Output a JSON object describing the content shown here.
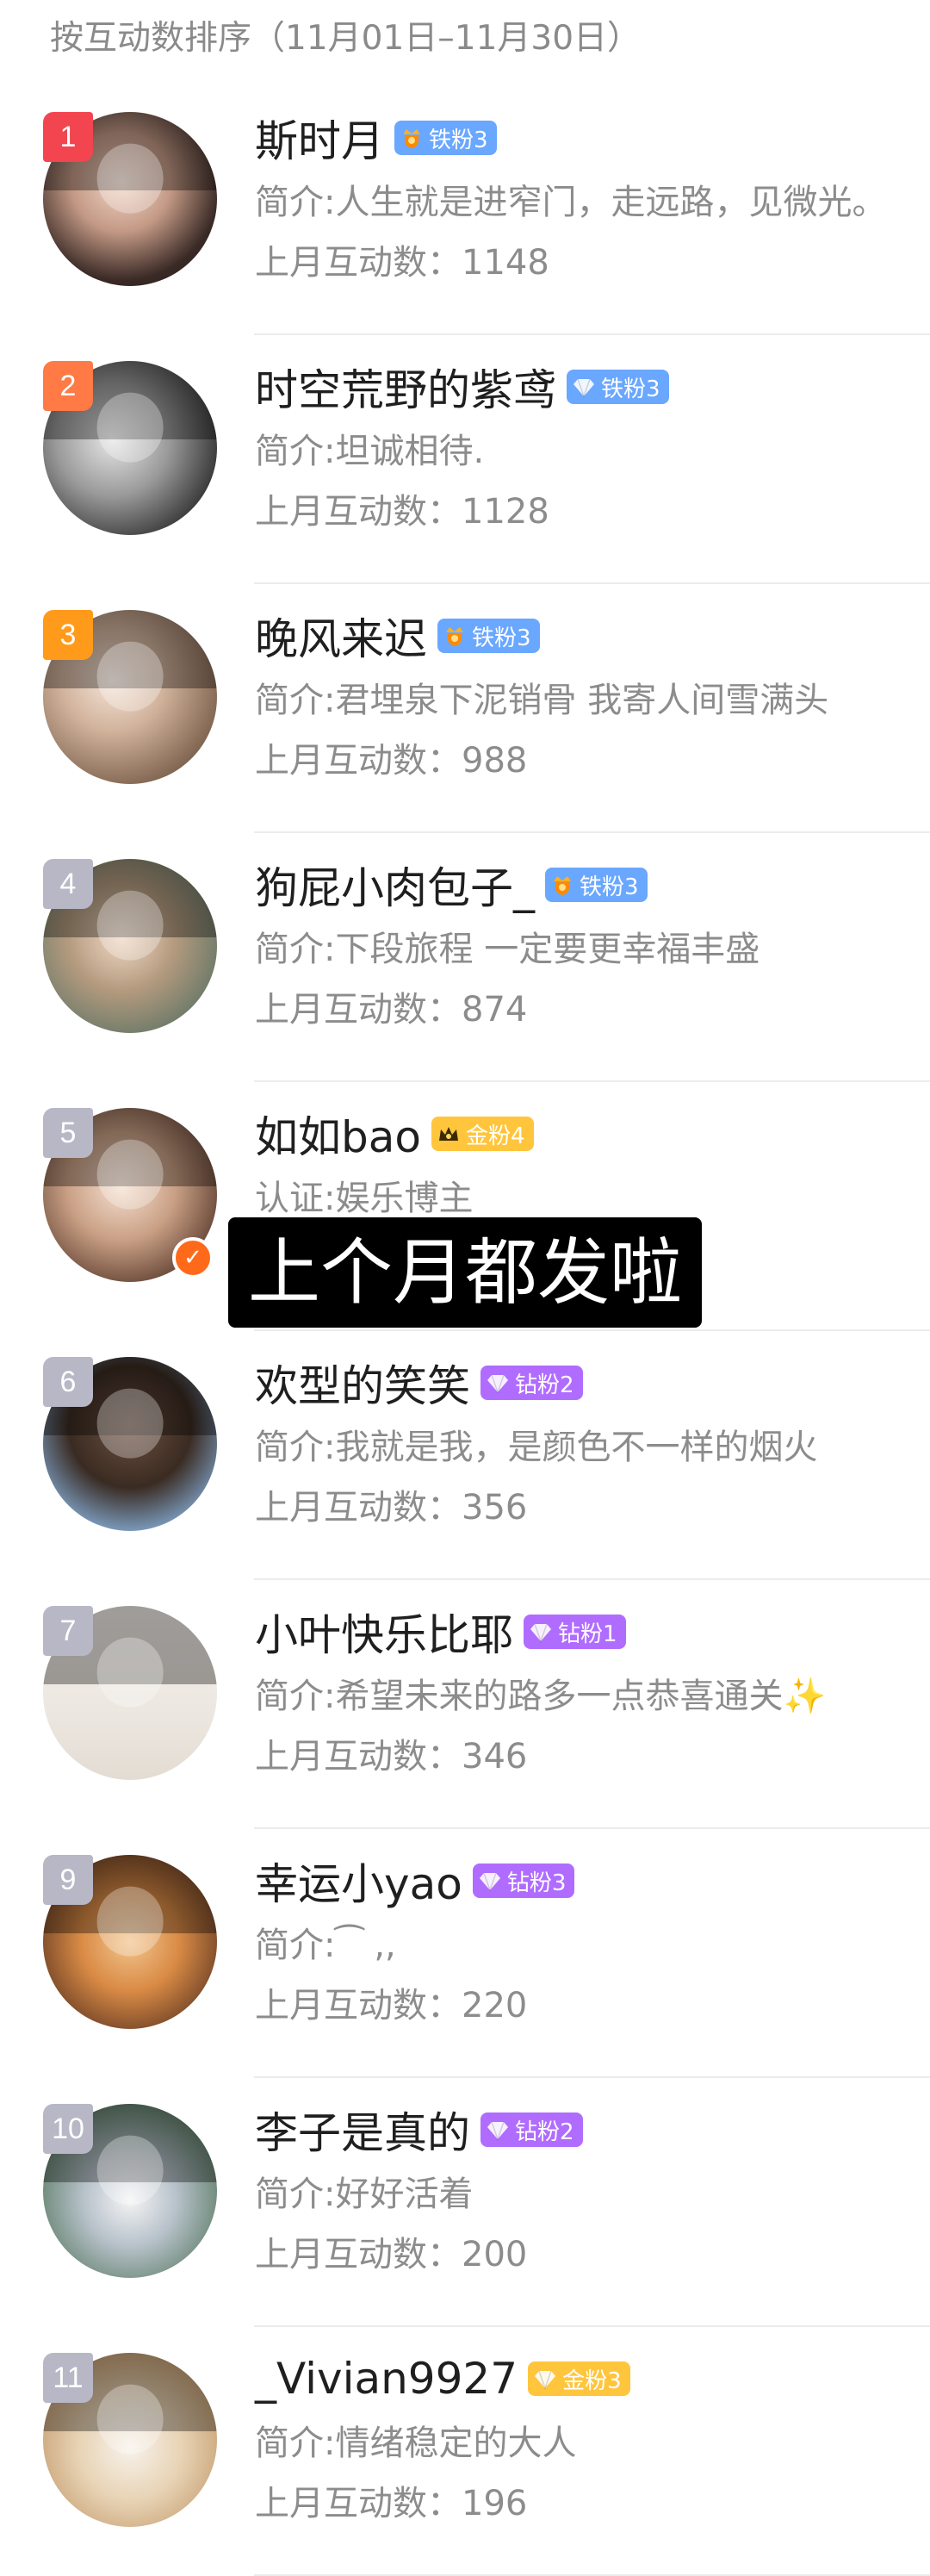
{
  "header": {
    "title": "按互动数排序（11月01日–11月30日）"
  },
  "caption": "上个月都发啦",
  "colors": {
    "rank_top1": "#f2454f",
    "rank_top2": "#ff7a45",
    "rank_top3": "#ff9a1a",
    "rank_default": "#b7b7c6",
    "badge_iron": "#6aa7ff",
    "badge_gold": "#ffc53d",
    "badge_diamond": "#b06cff",
    "verified": "#ff6a1a"
  },
  "users": [
    {
      "rank": "1",
      "name": "斯时月",
      "badge": "铁粉3",
      "badge_type": "iron",
      "badge_icon": "crown-shield-icon",
      "intro": "简介:人生就是进窄门，走远路，见微光。",
      "count": "上月互动数：1148",
      "verified": false
    },
    {
      "rank": "2",
      "name": "时空荒野的紫鸢",
      "badge": "铁粉3",
      "badge_type": "iron",
      "badge_icon": "diamond-icon",
      "intro": "简介:坦诚相待.",
      "count": "上月互动数：1128",
      "verified": false
    },
    {
      "rank": "3",
      "name": "晚风来迟",
      "badge": "铁粉3",
      "badge_type": "iron",
      "badge_icon": "crown-shield-icon",
      "intro": "简介:君埋泉下泥销骨 我寄人间雪满头",
      "count": "上月互动数：988",
      "verified": false
    },
    {
      "rank": "4",
      "name": "狗屁小肉包子_",
      "badge": "铁粉3",
      "badge_type": "iron",
      "badge_icon": "crown-shield-icon",
      "intro": "简介:下段旅程 一定要更幸福丰盛",
      "count": "上月互动数：874",
      "verified": false
    },
    {
      "rank": "5",
      "name": "如如bao",
      "badge": "金粉4",
      "badge_type": "gold",
      "badge_icon": "crown-icon",
      "intro": "认证:娱乐博主",
      "count": "",
      "verified": true
    },
    {
      "rank": "6",
      "name": "欢型的笑笑",
      "badge": "钻粉2",
      "badge_type": "diamond",
      "badge_icon": "diamond-icon",
      "intro": "简介:我就是我，是颜色不一样的烟火",
      "count": "上月互动数：356",
      "verified": false
    },
    {
      "rank": "7",
      "name": "小叶快乐比耶",
      "badge": "钻粉1",
      "badge_type": "diamond",
      "badge_icon": "diamond-icon",
      "intro": "简介:希望未来的路多一点恭喜通关✨",
      "count": "上月互动数：346",
      "verified": false
    },
    {
      "rank": "9",
      "name": "幸运小yao",
      "badge": "钻粉3",
      "badge_type": "diamond",
      "badge_icon": "diamond-icon",
      "intro": "简介:⁀ ,,",
      "count": "上月互动数：220",
      "verified": false
    },
    {
      "rank": "10",
      "name": "李子是真的",
      "badge": "钻粉2",
      "badge_type": "diamond",
      "badge_icon": "diamond-icon",
      "intro": "简介:好好活着",
      "count": "上月互动数：200",
      "verified": false
    },
    {
      "rank": "11",
      "name": "_Vivian9927",
      "badge": "金粉3",
      "badge_type": "gold",
      "badge_icon": "diamond-icon",
      "intro": "简介:情绪稳定的大人",
      "count": "上月互动数：196",
      "verified": false
    }
  ]
}
